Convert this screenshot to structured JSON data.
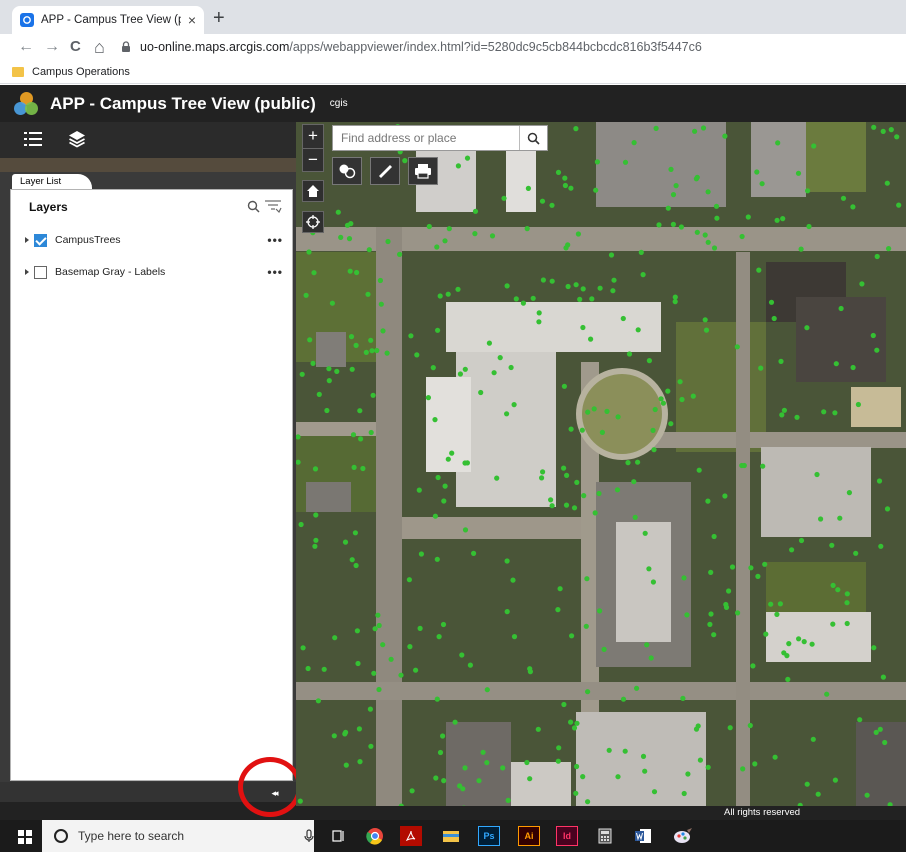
{
  "browser": {
    "tab_title": "APP - Campus Tree View (public)",
    "tab_close": "×",
    "new_tab": "+",
    "back": "←",
    "forward": "→",
    "reload": "C",
    "home": "⌂",
    "url_host": "uo-online.maps.arcgis.com",
    "url_path": "/apps/webappviewer/index.html?id=5280dc9c5cb844bcbcdc816b3f5447c6",
    "bookmarks": [
      "Campus Operations"
    ]
  },
  "app": {
    "title": "APP - Campus Tree View (public)",
    "subtitle": "cgis"
  },
  "layer_panel": {
    "tab_label": "Layer List",
    "header": "Layers",
    "layers": [
      {
        "name": "CampusTrees",
        "checked": true
      },
      {
        "name": "Basemap Gray - Labels",
        "checked": false
      }
    ],
    "more": "•••",
    "collapse": "◂◂"
  },
  "map": {
    "zoom_in": "+",
    "zoom_out": "−",
    "search_placeholder": "Find address or place",
    "attribution": "All rights reserved"
  },
  "taskbar": {
    "search_placeholder": "Type here to search",
    "apps": [
      "Ps",
      "Ai",
      "Id"
    ]
  },
  "colors": {
    "header": "#222222",
    "checkbox": "#2d88d8",
    "tree_point": "#35c033",
    "highlight_ring": "#e11111"
  }
}
